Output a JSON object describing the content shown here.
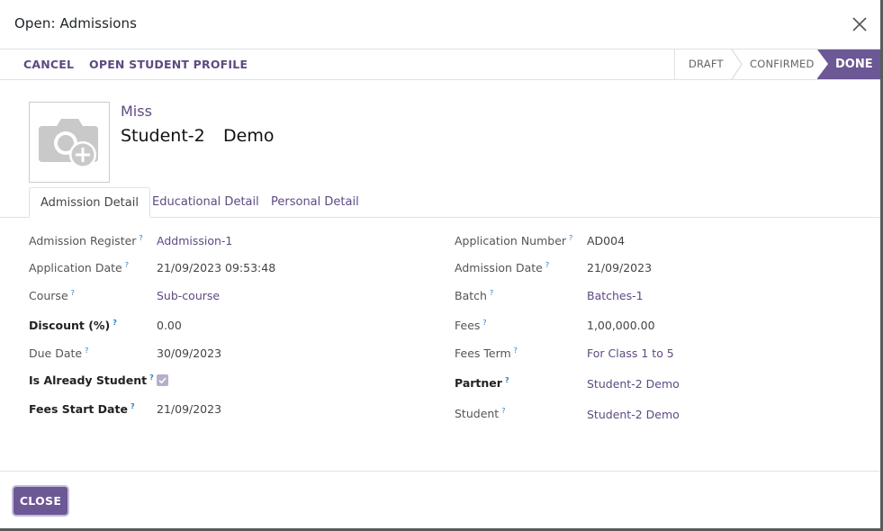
{
  "dialog": {
    "title": "Open: Admissions"
  },
  "control": {
    "cancel_label": "CANCEL",
    "open_profile_label": "OPEN STUDENT PROFILE"
  },
  "statusbar": {
    "stages": [
      "DRAFT",
      "CONFIRMED",
      "DONE"
    ],
    "active": "DONE",
    "active_color": "#6c5894"
  },
  "student": {
    "title": "Miss",
    "first_name": "Student-2",
    "last_name": "Demo",
    "avatar_icon": "camera-plus-icon"
  },
  "tabs": [
    "Admission Detail",
    "Educational Detail",
    "Personal Detail"
  ],
  "left_fields": [
    {
      "label": "Admission Register",
      "value": "Addmission-1"
    },
    {
      "label": "Application Date",
      "value": "21/09/2023 09:53:48"
    },
    {
      "label": "Course",
      "value": "Sub-course"
    },
    {
      "label": "Discount (%)",
      "value": "0.00"
    },
    {
      "label": "Due Date",
      "value": "30/09/2023"
    },
    {
      "label": "Is Already Student",
      "value": "checked"
    },
    {
      "label": "Fees Start Date",
      "value": "21/09/2023"
    }
  ],
  "right_fields": [
    {
      "label": "Application Number",
      "value": "AD004"
    },
    {
      "label": "Admission Date",
      "value": "21/09/2023"
    },
    {
      "label": "Batch",
      "value": "Batches-1"
    },
    {
      "label": "Fees",
      "value": "1,00,000.00"
    },
    {
      "label": "Fees Term",
      "value": "For Class 1 to 5"
    },
    {
      "label": "Partner",
      "value": "Student-2 Demo"
    },
    {
      "label": "Student",
      "value": "Student-2 Demo"
    }
  ],
  "help_mark": "?",
  "footer": {
    "close_label": "CLOSE"
  }
}
